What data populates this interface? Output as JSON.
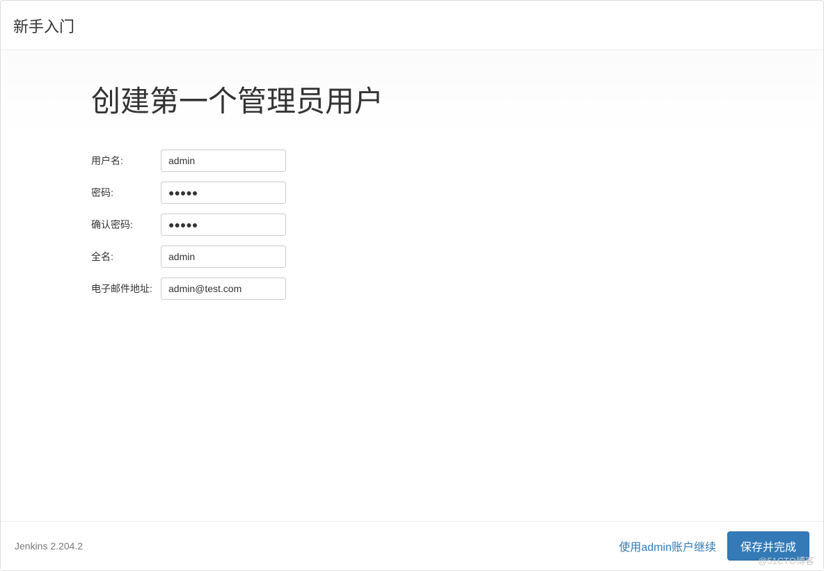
{
  "header": {
    "title": "新手入门"
  },
  "main": {
    "heading": "创建第一个管理员用户",
    "form": {
      "username": {
        "label": "用户名:",
        "value": "admin"
      },
      "password": {
        "label": "密码:",
        "value": "●●●●●"
      },
      "confirm_password": {
        "label": "确认密码:",
        "value": "●●●●●"
      },
      "fullname": {
        "label": "全名:",
        "value": "admin"
      },
      "email": {
        "label": "电子邮件地址:",
        "value": "admin@test.com"
      }
    }
  },
  "footer": {
    "version": "Jenkins 2.204.2",
    "continue_as_admin": "使用admin账户继续",
    "save_and_finish": "保存并完成"
  },
  "watermark": "@51CTO博客"
}
